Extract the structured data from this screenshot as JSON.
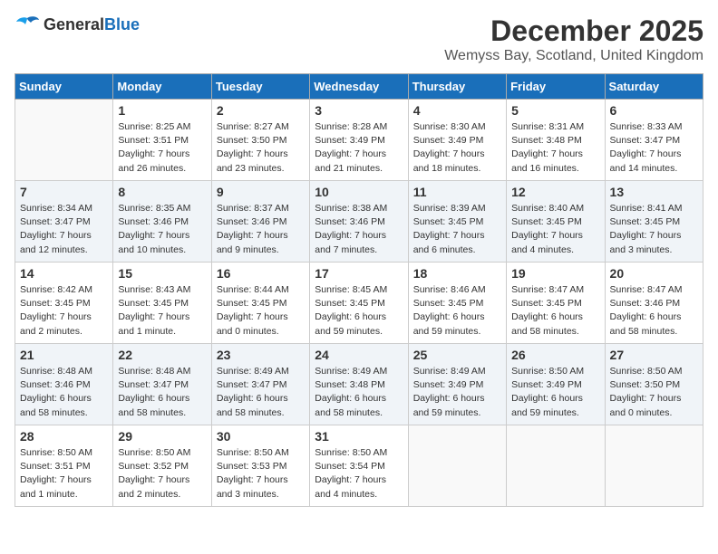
{
  "logo": {
    "text_general": "General",
    "text_blue": "Blue"
  },
  "title": {
    "month": "December 2025",
    "location": "Wemyss Bay, Scotland, United Kingdom"
  },
  "days_of_week": [
    "Sunday",
    "Monday",
    "Tuesday",
    "Wednesday",
    "Thursday",
    "Friday",
    "Saturday"
  ],
  "weeks": [
    [
      {
        "day": "",
        "sunrise": "",
        "sunset": "",
        "daylight": ""
      },
      {
        "day": "1",
        "sunrise": "Sunrise: 8:25 AM",
        "sunset": "Sunset: 3:51 PM",
        "daylight": "Daylight: 7 hours and 26 minutes."
      },
      {
        "day": "2",
        "sunrise": "Sunrise: 8:27 AM",
        "sunset": "Sunset: 3:50 PM",
        "daylight": "Daylight: 7 hours and 23 minutes."
      },
      {
        "day": "3",
        "sunrise": "Sunrise: 8:28 AM",
        "sunset": "Sunset: 3:49 PM",
        "daylight": "Daylight: 7 hours and 21 minutes."
      },
      {
        "day": "4",
        "sunrise": "Sunrise: 8:30 AM",
        "sunset": "Sunset: 3:49 PM",
        "daylight": "Daylight: 7 hours and 18 minutes."
      },
      {
        "day": "5",
        "sunrise": "Sunrise: 8:31 AM",
        "sunset": "Sunset: 3:48 PM",
        "daylight": "Daylight: 7 hours and 16 minutes."
      },
      {
        "day": "6",
        "sunrise": "Sunrise: 8:33 AM",
        "sunset": "Sunset: 3:47 PM",
        "daylight": "Daylight: 7 hours and 14 minutes."
      }
    ],
    [
      {
        "day": "7",
        "sunrise": "Sunrise: 8:34 AM",
        "sunset": "Sunset: 3:47 PM",
        "daylight": "Daylight: 7 hours and 12 minutes."
      },
      {
        "day": "8",
        "sunrise": "Sunrise: 8:35 AM",
        "sunset": "Sunset: 3:46 PM",
        "daylight": "Daylight: 7 hours and 10 minutes."
      },
      {
        "day": "9",
        "sunrise": "Sunrise: 8:37 AM",
        "sunset": "Sunset: 3:46 PM",
        "daylight": "Daylight: 7 hours and 9 minutes."
      },
      {
        "day": "10",
        "sunrise": "Sunrise: 8:38 AM",
        "sunset": "Sunset: 3:46 PM",
        "daylight": "Daylight: 7 hours and 7 minutes."
      },
      {
        "day": "11",
        "sunrise": "Sunrise: 8:39 AM",
        "sunset": "Sunset: 3:45 PM",
        "daylight": "Daylight: 7 hours and 6 minutes."
      },
      {
        "day": "12",
        "sunrise": "Sunrise: 8:40 AM",
        "sunset": "Sunset: 3:45 PM",
        "daylight": "Daylight: 7 hours and 4 minutes."
      },
      {
        "day": "13",
        "sunrise": "Sunrise: 8:41 AM",
        "sunset": "Sunset: 3:45 PM",
        "daylight": "Daylight: 7 hours and 3 minutes."
      }
    ],
    [
      {
        "day": "14",
        "sunrise": "Sunrise: 8:42 AM",
        "sunset": "Sunset: 3:45 PM",
        "daylight": "Daylight: 7 hours and 2 minutes."
      },
      {
        "day": "15",
        "sunrise": "Sunrise: 8:43 AM",
        "sunset": "Sunset: 3:45 PM",
        "daylight": "Daylight: 7 hours and 1 minute."
      },
      {
        "day": "16",
        "sunrise": "Sunrise: 8:44 AM",
        "sunset": "Sunset: 3:45 PM",
        "daylight": "Daylight: 7 hours and 0 minutes."
      },
      {
        "day": "17",
        "sunrise": "Sunrise: 8:45 AM",
        "sunset": "Sunset: 3:45 PM",
        "daylight": "Daylight: 6 hours and 59 minutes."
      },
      {
        "day": "18",
        "sunrise": "Sunrise: 8:46 AM",
        "sunset": "Sunset: 3:45 PM",
        "daylight": "Daylight: 6 hours and 59 minutes."
      },
      {
        "day": "19",
        "sunrise": "Sunrise: 8:47 AM",
        "sunset": "Sunset: 3:45 PM",
        "daylight": "Daylight: 6 hours and 58 minutes."
      },
      {
        "day": "20",
        "sunrise": "Sunrise: 8:47 AM",
        "sunset": "Sunset: 3:46 PM",
        "daylight": "Daylight: 6 hours and 58 minutes."
      }
    ],
    [
      {
        "day": "21",
        "sunrise": "Sunrise: 8:48 AM",
        "sunset": "Sunset: 3:46 PM",
        "daylight": "Daylight: 6 hours and 58 minutes."
      },
      {
        "day": "22",
        "sunrise": "Sunrise: 8:48 AM",
        "sunset": "Sunset: 3:47 PM",
        "daylight": "Daylight: 6 hours and 58 minutes."
      },
      {
        "day": "23",
        "sunrise": "Sunrise: 8:49 AM",
        "sunset": "Sunset: 3:47 PM",
        "daylight": "Daylight: 6 hours and 58 minutes."
      },
      {
        "day": "24",
        "sunrise": "Sunrise: 8:49 AM",
        "sunset": "Sunset: 3:48 PM",
        "daylight": "Daylight: 6 hours and 58 minutes."
      },
      {
        "day": "25",
        "sunrise": "Sunrise: 8:49 AM",
        "sunset": "Sunset: 3:49 PM",
        "daylight": "Daylight: 6 hours and 59 minutes."
      },
      {
        "day": "26",
        "sunrise": "Sunrise: 8:50 AM",
        "sunset": "Sunset: 3:49 PM",
        "daylight": "Daylight: 6 hours and 59 minutes."
      },
      {
        "day": "27",
        "sunrise": "Sunrise: 8:50 AM",
        "sunset": "Sunset: 3:50 PM",
        "daylight": "Daylight: 7 hours and 0 minutes."
      }
    ],
    [
      {
        "day": "28",
        "sunrise": "Sunrise: 8:50 AM",
        "sunset": "Sunset: 3:51 PM",
        "daylight": "Daylight: 7 hours and 1 minute."
      },
      {
        "day": "29",
        "sunrise": "Sunrise: 8:50 AM",
        "sunset": "Sunset: 3:52 PM",
        "daylight": "Daylight: 7 hours and 2 minutes."
      },
      {
        "day": "30",
        "sunrise": "Sunrise: 8:50 AM",
        "sunset": "Sunset: 3:53 PM",
        "daylight": "Daylight: 7 hours and 3 minutes."
      },
      {
        "day": "31",
        "sunrise": "Sunrise: 8:50 AM",
        "sunset": "Sunset: 3:54 PM",
        "daylight": "Daylight: 7 hours and 4 minutes."
      },
      {
        "day": "",
        "sunrise": "",
        "sunset": "",
        "daylight": ""
      },
      {
        "day": "",
        "sunrise": "",
        "sunset": "",
        "daylight": ""
      },
      {
        "day": "",
        "sunrise": "",
        "sunset": "",
        "daylight": ""
      }
    ]
  ]
}
